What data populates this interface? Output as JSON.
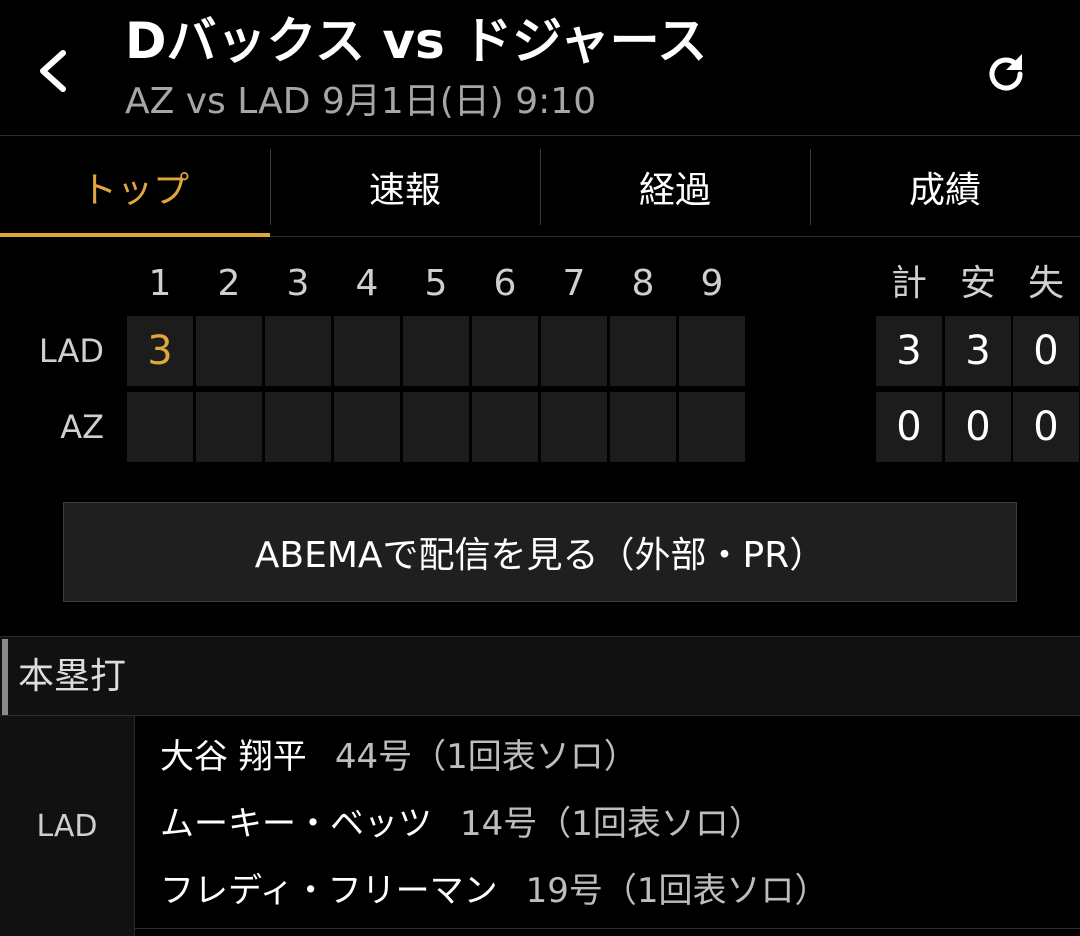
{
  "header": {
    "title": "Dバックス vs ドジャース",
    "subtitle": "AZ vs LAD 9月1日(日) 9:10",
    "back_icon": "chevron-left-icon",
    "refresh_icon": "refresh-icon"
  },
  "tabs": [
    {
      "label": "トップ",
      "active": true
    },
    {
      "label": "速報",
      "active": false
    },
    {
      "label": "経過",
      "active": false
    },
    {
      "label": "成績",
      "active": false
    }
  ],
  "scoreboard": {
    "innings": [
      "1",
      "2",
      "3",
      "4",
      "5",
      "6",
      "7",
      "8",
      "9"
    ],
    "totals_headers": [
      "計",
      "安",
      "失"
    ],
    "rows": [
      {
        "team": "LAD",
        "innings": [
          "3",
          "",
          "",
          "",
          "",
          "",
          "",
          "",
          ""
        ],
        "totals": [
          "3",
          "3",
          "0"
        ]
      },
      {
        "team": "AZ",
        "innings": [
          "",
          "",
          "",
          "",
          "",
          "",
          "",
          "",
          ""
        ],
        "totals": [
          "0",
          "0",
          "0"
        ]
      }
    ]
  },
  "abema_button": {
    "label": "ABEMAで配信を見る（外部・PR）"
  },
  "home_runs": {
    "section_label": "本塁打",
    "team": "LAD",
    "items": [
      {
        "player": "大谷 翔平",
        "info": "44号（1回表ソロ）"
      },
      {
        "player": "ムーキー・ベッツ",
        "info": "14号（1回表ソロ）"
      },
      {
        "player": "フレディ・フリーマン",
        "info": "19号（1回表ソロ）"
      }
    ]
  },
  "colors": {
    "accent": "#e0a63c",
    "background": "#000000",
    "cell": "#1c1c1c"
  }
}
